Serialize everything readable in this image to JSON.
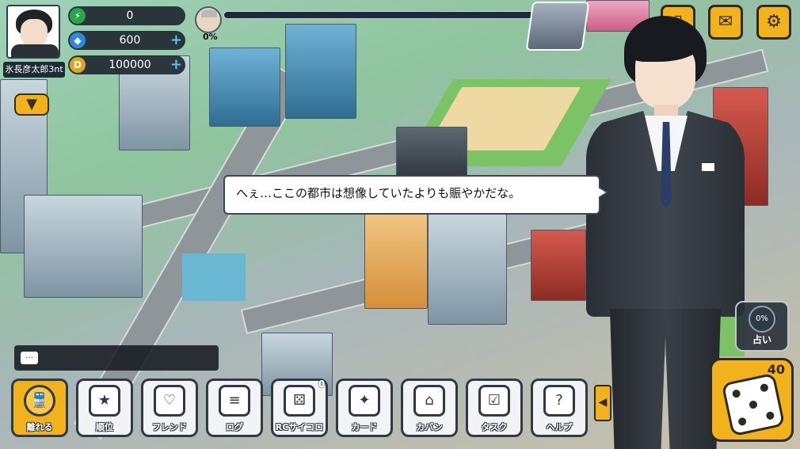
{
  "player": {
    "name": "氷長彦太郎3nt"
  },
  "resources": [
    {
      "icon": "lightning-icon",
      "glyph": "⚡",
      "value": "0",
      "has_plus": false
    },
    {
      "icon": "diamond-icon",
      "glyph": "◆",
      "value": "600",
      "has_plus": true
    },
    {
      "icon": "coin-icon",
      "glyph": "D",
      "value": "100000",
      "has_plus": true
    }
  ],
  "plus_glyph": "+",
  "rival": {
    "percent": "0%",
    "progress": 0
  },
  "top_buttons": [
    {
      "name": "phone-button",
      "icon": "smartphone-icon",
      "glyph": "▯"
    },
    {
      "name": "mail-button",
      "icon": "mail-icon",
      "glyph": "✉"
    },
    {
      "name": "settings-button",
      "icon": "gear-icon",
      "glyph": "⚙"
    }
  ],
  "dialogue": {
    "text": "へぇ…ここの都市は想像していたよりも賑やかだな。"
  },
  "fortune": {
    "percent": "0%",
    "label": "占い"
  },
  "dice": {
    "count": "40"
  },
  "menu_arrow_glyph": "▼",
  "side_arrow_glyph": "◀",
  "chat_glyph": "…",
  "rc_dice_count": "0",
  "bottom_menu": [
    {
      "name": "leave-button",
      "icon": "train-icon",
      "glyph": "🚆",
      "label": "離れる",
      "gold": true
    },
    {
      "name": "ranking-button",
      "icon": "ranking-icon",
      "glyph": "★",
      "label": "順位",
      "gold": false
    },
    {
      "name": "friend-button",
      "icon": "heart-icon",
      "glyph": "♡",
      "label": "フレンド",
      "gold": false
    },
    {
      "name": "log-button",
      "icon": "log-icon",
      "glyph": "≡",
      "label": "ログ",
      "gold": false
    },
    {
      "name": "rc-dice-button",
      "icon": "remote-dice-icon",
      "glyph": "⚄",
      "label": "RCサイコロ",
      "gold": false
    },
    {
      "name": "card-button",
      "icon": "card-icon",
      "glyph": "✦",
      "label": "カード",
      "gold": false
    },
    {
      "name": "bag-button",
      "icon": "bag-icon",
      "glyph": "⌂",
      "label": "カバン",
      "gold": false
    },
    {
      "name": "task-button",
      "icon": "task-icon",
      "glyph": "☑",
      "label": "タスク",
      "gold": false
    },
    {
      "name": "help-button",
      "icon": "help-icon",
      "glyph": "?",
      "label": "ヘルプ",
      "gold": false
    }
  ],
  "colors": {
    "accent": "#f2b21c",
    "panel": "#1f2a35",
    "outline": "#2f3a46"
  }
}
